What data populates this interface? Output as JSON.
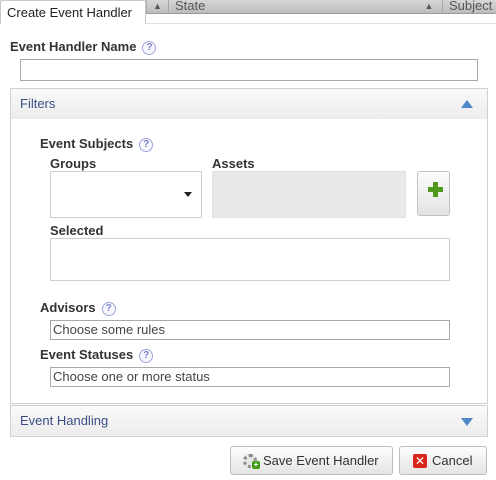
{
  "background_grid": {
    "sort_glyph": "▲",
    "columns": [
      "State",
      "Subject"
    ]
  },
  "dialog": {
    "tab_title": "Create Event Handler",
    "name_field": {
      "label": "Event Handler Name",
      "help": "?",
      "value": ""
    },
    "filters": {
      "header": "Filters",
      "event_subjects": {
        "label": "Event Subjects",
        "help": "?",
        "groups_label": "Groups",
        "groups_value": "",
        "assets_label": "Assets",
        "selected_label": "Selected"
      },
      "advisors": {
        "label": "Advisors",
        "help": "?",
        "placeholder": "Choose some rules"
      },
      "event_statuses": {
        "label": "Event Statuses",
        "help": "?",
        "placeholder": "Choose one or more status"
      }
    },
    "event_handling": {
      "header": "Event Handling"
    },
    "buttons": {
      "save": "Save Event Handler",
      "cancel": "Cancel"
    }
  },
  "colors": {
    "panel_header_text": "#3a4e86",
    "accent_arrow": "#4d86c9",
    "add_green": "#4f9a1c",
    "cancel_red": "#d7261c"
  }
}
